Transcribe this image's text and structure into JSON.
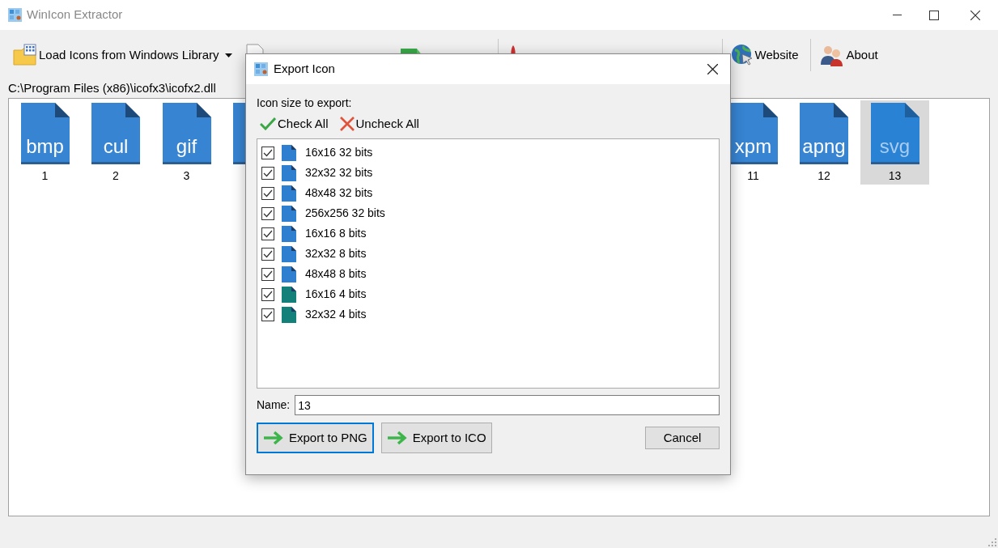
{
  "window": {
    "title": "WinIcon Extractor"
  },
  "toolbar": [
    {
      "kind": "library",
      "label": "Load Icons from Windows Library"
    },
    {
      "kind": "file"
    },
    {
      "kind": "export"
    },
    {
      "kind": "optimize"
    },
    {
      "kind": "website",
      "label": "Website"
    },
    {
      "kind": "about",
      "label": "About"
    }
  ],
  "path": "C:\\Program Files (x86)\\icofx3\\icofx2.dll",
  "icons": [
    {
      "kind": "file",
      "ext": "bmp",
      "label": "1",
      "selected": false
    },
    {
      "kind": "file",
      "ext": "cul",
      "label": "2",
      "selected": false
    },
    {
      "kind": "file",
      "ext": "gif",
      "label": "3",
      "selected": false
    },
    {
      "kind": "partial"
    },
    {
      "kind": "covered"
    },
    {
      "kind": "covered"
    },
    {
      "kind": "covered"
    },
    {
      "kind": "covered"
    },
    {
      "kind": "covered"
    },
    {
      "kind": "covered"
    },
    {
      "kind": "file",
      "ext": "xpm",
      "label": "11",
      "selected": false
    },
    {
      "kind": "file",
      "ext": "apng",
      "label": "12",
      "selected": false
    },
    {
      "kind": "file",
      "ext": "svg",
      "label": "13",
      "selected": true
    }
  ],
  "dialog": {
    "title": "Export Icon",
    "prompt": "Icon size to export:",
    "check_all": "Check All",
    "uncheck_all": "Uncheck All",
    "sizes": [
      {
        "label": "16x16 32 bits",
        "checked": true,
        "color": "#2f7fd0"
      },
      {
        "label": "32x32 32 bits",
        "checked": true,
        "color": "#2f7fd0"
      },
      {
        "label": "48x48 32 bits",
        "checked": true,
        "color": "#2f7fd0"
      },
      {
        "label": "256x256 32 bits",
        "checked": true,
        "color": "#2f7fd0"
      },
      {
        "label": "16x16 8 bits",
        "checked": true,
        "color": "#2f7fd0"
      },
      {
        "label": "32x32 8 bits",
        "checked": true,
        "color": "#2f7fd0"
      },
      {
        "label": "48x48 8 bits",
        "checked": true,
        "color": "#2f7fd0"
      },
      {
        "label": "16x16 4 bits",
        "checked": true,
        "color": "#14807a"
      },
      {
        "label": "32x32 4 bits",
        "checked": true,
        "color": "#14807a"
      }
    ],
    "name_label": "Name:",
    "name_value": "13",
    "buttons": [
      {
        "kind": "arrow",
        "label": "Export to PNG",
        "selected": true
      },
      {
        "kind": "arrow",
        "label": "Export to ICO",
        "selected": false
      },
      {
        "kind": "plain",
        "label": "Cancel",
        "selected": false
      }
    ]
  }
}
